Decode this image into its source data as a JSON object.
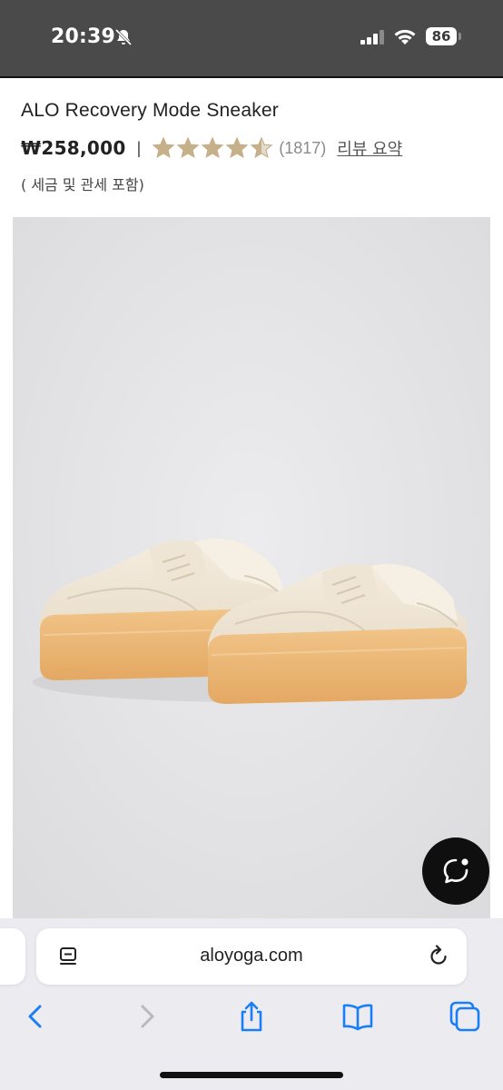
{
  "status_bar": {
    "time": "20:39",
    "battery": "86",
    "icons": [
      "bell-slash-icon",
      "signal-icon",
      "wifi-icon",
      "battery-icon"
    ]
  },
  "product": {
    "title": "ALO Recovery Mode Sneaker",
    "price": "₩258,000",
    "separator": "|",
    "rating": 4.5,
    "rating_max": 5,
    "review_count": "(1817)",
    "review_summary_link": "리뷰 요약",
    "tax_note": "( 세금 및 관세 포함)",
    "star_color": "#c6b08a",
    "star_empty_color": "#e3dccd"
  },
  "browser": {
    "url": "aloyoga.com",
    "toolbar": [
      "back-icon",
      "forward-icon",
      "share-icon",
      "bookmarks-icon",
      "tabs-icon"
    ],
    "accent_color": "#1a7ef5"
  },
  "chat": {
    "icon": "chat-bubble-icon"
  }
}
